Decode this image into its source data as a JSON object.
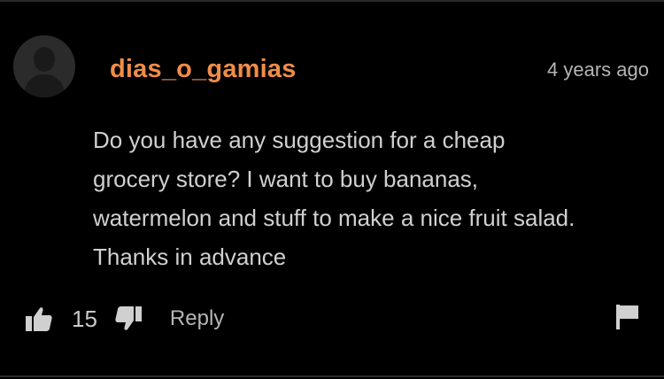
{
  "comment": {
    "username": "dias_o_gamias",
    "timestamp": "4 years ago",
    "body_lines": [
      "Do you have any suggestion for a cheap",
      "grocery store? I want to buy bananas,",
      "watermelon and stuff to make a nice fruit salad.",
      "Thanks in advance"
    ],
    "vote_count": "15",
    "reply_label": "Reply",
    "avatar_icon": "default-user-avatar-icon"
  },
  "icons": {
    "thumbs_up": "thumbs-up-icon",
    "thumbs_down": "thumbs-down-icon",
    "flag": "flag-icon"
  },
  "colors": {
    "background": "#000000",
    "username": "#f08d49",
    "text": "#d0d0d0",
    "muted": "#b5b5b5"
  }
}
